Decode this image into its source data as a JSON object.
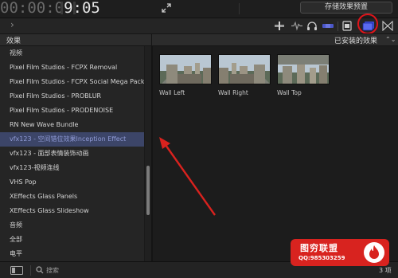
{
  "viewer": {
    "timecode_prefix": "00:00:0",
    "timecode_main": "9:05"
  },
  "toolbar": {
    "save_preset_label": "存储效果预置"
  },
  "browser": {
    "panel_title": "效果",
    "filter_label": "已安装的效果"
  },
  "categories": [
    {
      "label": "视频",
      "type": "heading"
    },
    {
      "label": "Pixel Film Studios - FCPX Removal",
      "type": "item"
    },
    {
      "label": "Pixel Film Studios - FCPX Social Mega Pack",
      "type": "item"
    },
    {
      "label": "Pixel Film Studios - PROBLUR",
      "type": "item"
    },
    {
      "label": "Pixel Film Studios - PRODENOISE",
      "type": "item"
    },
    {
      "label": "RN New Wave Bundle",
      "type": "item"
    },
    {
      "label": "vfx123 - 空间错位效果Inception Effect",
      "type": "item",
      "selected": true
    },
    {
      "label": "vfx123 - 面部表情装饰动画",
      "type": "item"
    },
    {
      "label": "vfx123-视频连线",
      "type": "item"
    },
    {
      "label": "VHS Pop",
      "type": "item"
    },
    {
      "label": "XEffects Glass Panels",
      "type": "item"
    },
    {
      "label": "XEffects Glass Slideshow",
      "type": "item"
    },
    {
      "label": "音频",
      "type": "heading"
    },
    {
      "label": "全部",
      "type": "item"
    },
    {
      "label": "电平",
      "type": "item"
    }
  ],
  "effects": [
    {
      "name": "Wall Left"
    },
    {
      "name": "Wall Right"
    },
    {
      "name": "Wall Top"
    }
  ],
  "search": {
    "placeholder": "搜索"
  },
  "result_count": "3 项",
  "watermark": {
    "title": "图穷联盟",
    "subtitle": "QQ:985303259"
  },
  "colors": {
    "selection": "#3c4568",
    "highlight_ring": "#e0141a",
    "arrow": "#d9221e"
  }
}
